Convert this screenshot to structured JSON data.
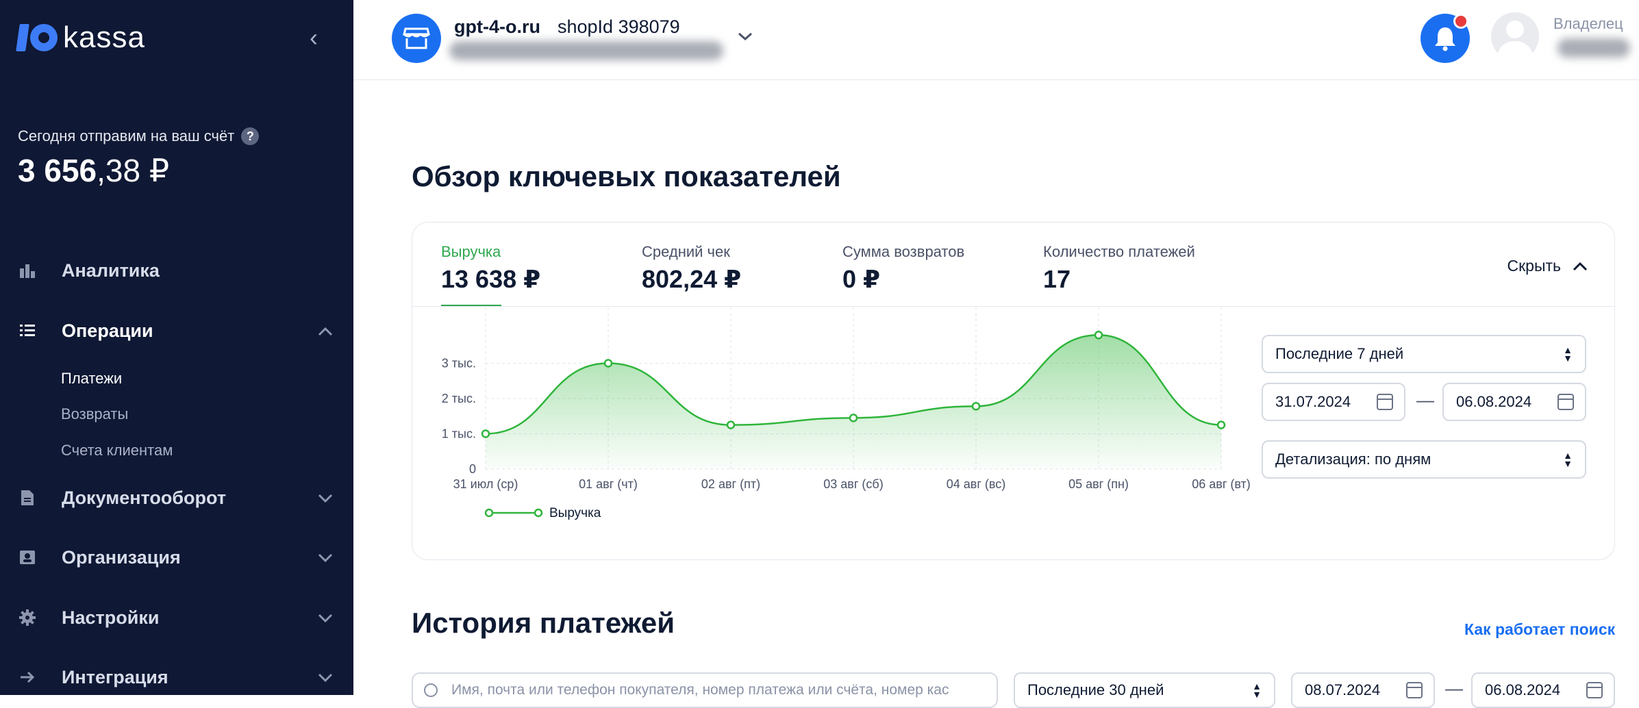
{
  "sidebar": {
    "logo_text": "kassa",
    "payout_label": "Сегодня отправим на ваш счёт",
    "payout_amount_int": "3 656",
    "payout_amount_frac": ",38 ₽",
    "nav": [
      {
        "label": "Аналитика"
      },
      {
        "label": "Операции"
      },
      {
        "label": "Документооборот"
      },
      {
        "label": "Организация"
      },
      {
        "label": "Настройки"
      },
      {
        "label": "Интеграция"
      }
    ],
    "sub": [
      "Платежи",
      "Возвраты",
      "Счета клиентам"
    ]
  },
  "topbar": {
    "store_name": "gpt-4-o.ru",
    "shop_id": "shopId 398079",
    "role": "Владелец"
  },
  "overview": {
    "title": "Обзор ключевых показателей",
    "metrics": [
      {
        "label": "Выручка",
        "value": "13 638 ₽"
      },
      {
        "label": "Средний чек",
        "value": "802,24 ₽"
      },
      {
        "label": "Сумма возвратов",
        "value": "0 ₽"
      },
      {
        "label": "Количество платежей",
        "value": "17"
      }
    ],
    "hide_label": "Скрыть",
    "period_select": "Последние 7 дней",
    "date_from": "31.07.2024",
    "date_to": "06.08.2024",
    "dash": "—",
    "detail_select": "Детализация: по дням"
  },
  "chart_data": {
    "type": "area",
    "categories": [
      "31 июл (ср)",
      "01 авг (чт)",
      "02 авг (пт)",
      "03 авг (сб)",
      "04 авг (вс)",
      "05 авг (пн)",
      "06 авг (вт)"
    ],
    "series": [
      {
        "name": "Выручка",
        "values": [
          1000,
          3000,
          1250,
          1450,
          1780,
          3800,
          1250
        ]
      }
    ],
    "y_ticks": [
      {
        "value": 0,
        "label": "0"
      },
      {
        "value": 1000,
        "label": "1 тыс."
      },
      {
        "value": 2000,
        "label": "2 тыс."
      },
      {
        "value": 3000,
        "label": "3 тыс."
      }
    ],
    "ylim": [
      0,
      3800
    ],
    "color": "#2fb53b",
    "grid": true,
    "legend": "bottom-left"
  },
  "history": {
    "title": "История платежей",
    "link": "Как работает поиск",
    "search_placeholder": "Имя, почта или телефон покупателя, номер платежа или счёта, номер кас",
    "period_select": "Последние 30 дней",
    "date_from": "08.07.2024",
    "date_to": "06.08.2024",
    "dash": "—"
  }
}
